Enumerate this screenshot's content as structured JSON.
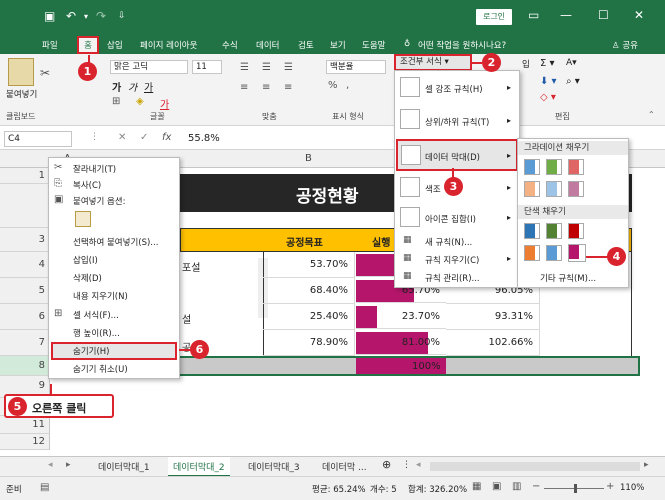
{
  "titlebar": {
    "login": "로그인"
  },
  "menu": {
    "file": "파일",
    "home": "홈",
    "insert": "삽입",
    "layout": "페이지 레이아웃",
    "formulas": "수식",
    "data": "데이터",
    "review": "검토",
    "view": "보기",
    "help": "도움말",
    "tell_me": "어떤 작업을 원하시나요?",
    "share": "공유"
  },
  "ribbon": {
    "paste": "붙여넣기",
    "font_name": "맑은 고딕",
    "font_size": "11",
    "number_format": "백분율",
    "cond_format": "조건부 서식",
    "insert_trunc": "입",
    "group_clipboard": "클립보드",
    "group_font": "글꼴",
    "group_align": "맞춤",
    "group_number": "표시 형식",
    "group_edit": "편집"
  },
  "formula": {
    "namebox": "C4",
    "value": "55.8%"
  },
  "columns": [
    "A",
    "B"
  ],
  "sheet": {
    "title": "공정현황",
    "hdr_goal": "공정목표",
    "hdr_actual": "실행",
    "a4_partial": "포설",
    "a6_partial": "설",
    "a7_partial": "공",
    "rows": [
      {
        "b": "53.70%",
        "c": "",
        "d": ""
      },
      {
        "b": "68.40%",
        "c": "65.70%",
        "d": "96.05%"
      },
      {
        "b": "25.40%",
        "c": "23.70%",
        "d": "93.31%"
      },
      {
        "b": "78.90%",
        "c": "81.00%",
        "d": "102.66%"
      }
    ],
    "row8_c": "100%",
    "row_numbers": [
      "1",
      "2",
      "3",
      "4",
      "5",
      "6",
      "7",
      "8",
      "9",
      "10",
      "11",
      "12"
    ]
  },
  "context_menu": {
    "cut": "잘라내기(T)",
    "copy": "복사(C)",
    "paste_options": "붙여넣기 옵션:",
    "paste_special": "선택하여 붙여넣기(S)...",
    "insert": "삽입(I)",
    "delete": "삭제(D)",
    "clear": "내용 지우기(N)",
    "format_cells": "셀 서식(F)...",
    "row_height": "행 높이(R)...",
    "hide": "숨기기(H)",
    "unhide": "숨기기 취소(U)"
  },
  "cf_menu": {
    "highlight": "셀 강조 규칙(H)",
    "topbottom": "상위/하위 규칙(T)",
    "databar": "데이터 막대(D)",
    "colorscale": "색조",
    "iconset": "아이콘 집합(I)",
    "new_rule": "새 규칙(N)...",
    "clear_rules": "규칙 지우기(C)",
    "manage": "규칙 관리(R)..."
  },
  "submenu": {
    "gradient": "그라데이션 채우기",
    "solid": "단색 채우기",
    "more": "기타 규칙(M)..."
  },
  "callouts": {
    "c1": "1",
    "c2": "2",
    "c3": "3",
    "c4": "4",
    "c5": "5",
    "c6": "6",
    "right_click": "오른쪽 클릭"
  },
  "tabs": [
    "데이터막대_1",
    "데이터막대_2",
    "데이터막대_3",
    "데이터막 ..."
  ],
  "status": {
    "ready": "준비",
    "average": "평균: 65.24%",
    "count": "개수: 5",
    "sum": "합계: 326.20%",
    "zoom": "110%"
  },
  "colors": {
    "excel_green": "#217346",
    "callout_red": "#d9232d",
    "magenta": "#b5166b",
    "title_dark": "#262626",
    "header_gold": "#ffc000"
  }
}
